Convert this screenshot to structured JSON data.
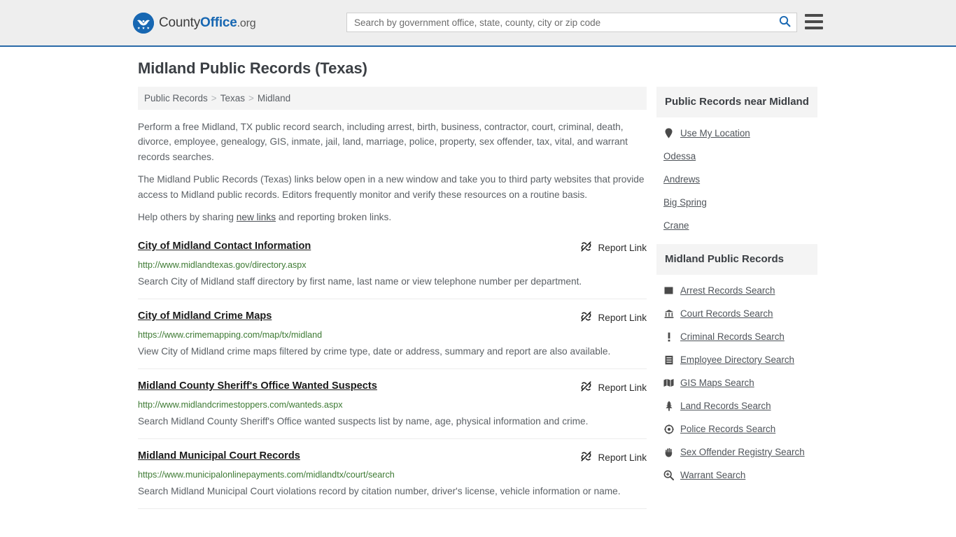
{
  "header": {
    "logo_text_county": "County",
    "logo_text_office": "Office",
    "logo_text_org": ".org",
    "logo_icon": "eagle-stars-seal-icon",
    "search": {
      "placeholder": "Search by government office, state, county, city or zip code",
      "value": "",
      "button_icon": "search-icon"
    },
    "menu_icon": "hamburger-menu-icon",
    "accent_color": "#1767b2",
    "background_color": "#eeeeee"
  },
  "page": {
    "title": "Midland Public Records (Texas)"
  },
  "breadcrumb": {
    "items": [
      {
        "label": "Public Records"
      },
      {
        "label": "Texas"
      },
      {
        "label": "Midland"
      }
    ],
    "separator": ">"
  },
  "intro": {
    "p1": "Perform a free Midland, TX public record search, including arrest, birth, business, contractor, court, criminal, death, divorce, employee, genealogy, GIS, inmate, jail, land, marriage, police, property, sex offender, tax, vital, and warrant records searches.",
    "p2": "The Midland Public Records (Texas) links below open in a new window and take you to third party websites that provide access to Midland public records. Editors frequently monitor and verify these resources on a routine basis.",
    "p3_before": "Help others by sharing ",
    "p3_link": "new links",
    "p3_after": " and reporting broken links."
  },
  "results": {
    "report_label": "Report Link",
    "report_icon": "broken-link-icon",
    "items": [
      {
        "title": "City of Midland Contact Information",
        "url": "http://www.midlandtexas.gov/directory.aspx",
        "description": "Search City of Midland staff directory by first name, last name or view telephone number per department."
      },
      {
        "title": "City of Midland Crime Maps",
        "url": "https://www.crimemapping.com/map/tx/midland",
        "description": "View City of Midland crime maps filtered by crime type, date or address, summary and report are also available."
      },
      {
        "title": "Midland County Sheriff's Office Wanted Suspects",
        "url": "http://www.midlandcrimestoppers.com/wanteds.aspx",
        "description": "Search Midland County Sheriff's Office wanted suspects list by name, age, physical information and crime."
      },
      {
        "title": "Midland Municipal Court Records",
        "url": "https://www.municipalonlinepayments.com/midlandtx/court/search",
        "description": "Search Midland Municipal Court violations record by citation number, driver's license, vehicle information or name."
      }
    ]
  },
  "sidebar": {
    "near_box": {
      "heading": "Public Records near Midland",
      "items": [
        {
          "label": "Use My Location",
          "icon": "map-pin-icon"
        },
        {
          "label": "Odessa",
          "icon": ""
        },
        {
          "label": "Andrews",
          "icon": ""
        },
        {
          "label": "Big Spring",
          "icon": ""
        },
        {
          "label": "Crane",
          "icon": ""
        }
      ]
    },
    "records_box": {
      "heading": "Midland Public Records",
      "items": [
        {
          "label": "Arrest Records Search",
          "icon": "fingerprint-icon"
        },
        {
          "label": "Court Records Search",
          "icon": "courthouse-icon"
        },
        {
          "label": "Criminal Records Search",
          "icon": "exclamation-icon"
        },
        {
          "label": "Employee Directory Search",
          "icon": "id-card-icon"
        },
        {
          "label": "GIS Maps Search",
          "icon": "map-icon"
        },
        {
          "label": "Land Records Search",
          "icon": "tree-icon"
        },
        {
          "label": "Police Records Search",
          "icon": "police-badge-icon"
        },
        {
          "label": "Sex Offender Registry Search",
          "icon": "hand-icon"
        },
        {
          "label": "Warrant Search",
          "icon": "search-plus-icon"
        }
      ]
    }
  }
}
